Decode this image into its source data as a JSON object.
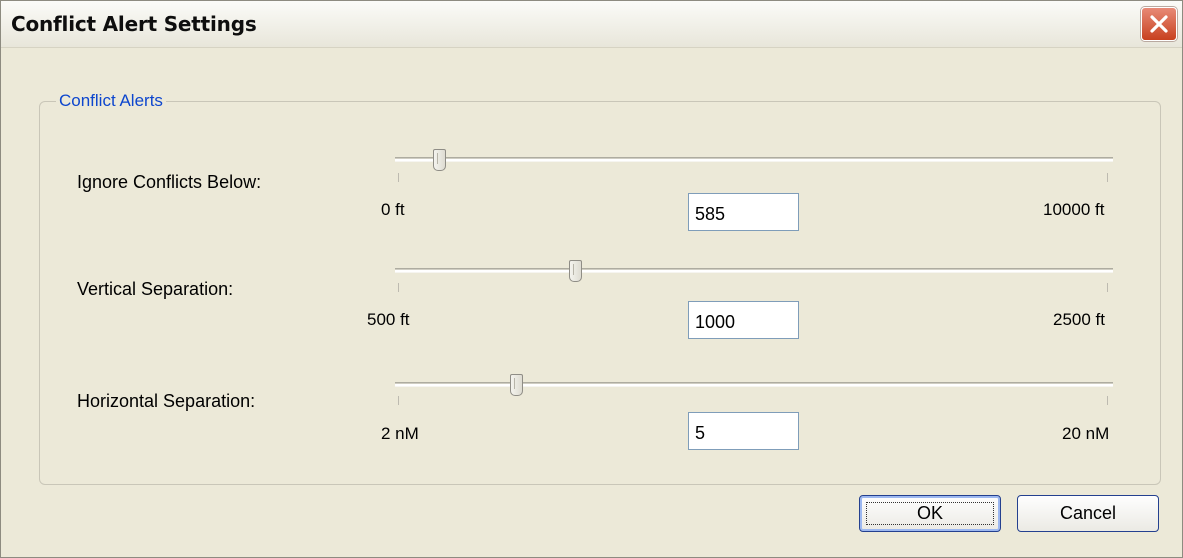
{
  "window": {
    "title": "Conflict Alert Settings",
    "close_icon": "close-icon",
    "accent_color": "#0d46ce",
    "close_color": "#c8401f"
  },
  "group": {
    "legend": "Conflict Alerts"
  },
  "settings": [
    {
      "label": "Ignore Conflicts Below:",
      "min_label": "0 ft",
      "max_label": "10000 ft",
      "value": "585",
      "min": 0,
      "max": 10000,
      "slider_value": 585
    },
    {
      "label": "Vertical Separation:",
      "min_label": "500 ft",
      "max_label": "2500 ft",
      "value": "1000",
      "min": 500,
      "max": 2500,
      "slider_value": 1000
    },
    {
      "label": "Horizontal Separation:",
      "min_label": "2 nM",
      "max_label": "20 nM",
      "value": "5",
      "min": 2,
      "max": 20,
      "slider_value": 5
    }
  ],
  "buttons": {
    "ok": "OK",
    "cancel": "Cancel"
  }
}
